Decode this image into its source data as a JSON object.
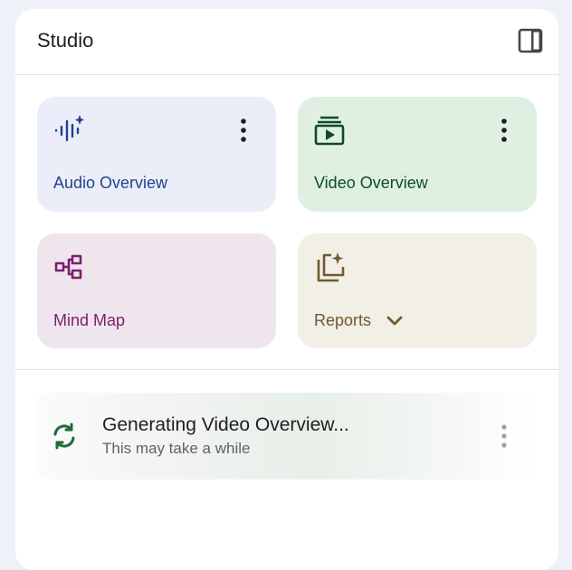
{
  "studio": {
    "title": "Studio",
    "toggle_icon": "side-panel-icon"
  },
  "cards": {
    "audio": {
      "label": "Audio Overview",
      "icon": "audio-waveform-sparkle-icon",
      "color": "#23418e"
    },
    "video": {
      "label": "Video Overview",
      "icon": "video-stack-play-icon",
      "color": "#0e4a25"
    },
    "mind_map": {
      "label": "Mind Map",
      "icon": "mind-map-icon",
      "color": "#7a2070"
    },
    "reports": {
      "label": "Reports",
      "icon": "reports-sparkle-icon",
      "dropdown_icon": "chevron-down-icon",
      "color": "#71592f"
    }
  },
  "generating": {
    "title": "Generating Video Overview...",
    "subtitle": "This may take a while",
    "icon": "sync-icon",
    "color": "#1e6b3a"
  }
}
